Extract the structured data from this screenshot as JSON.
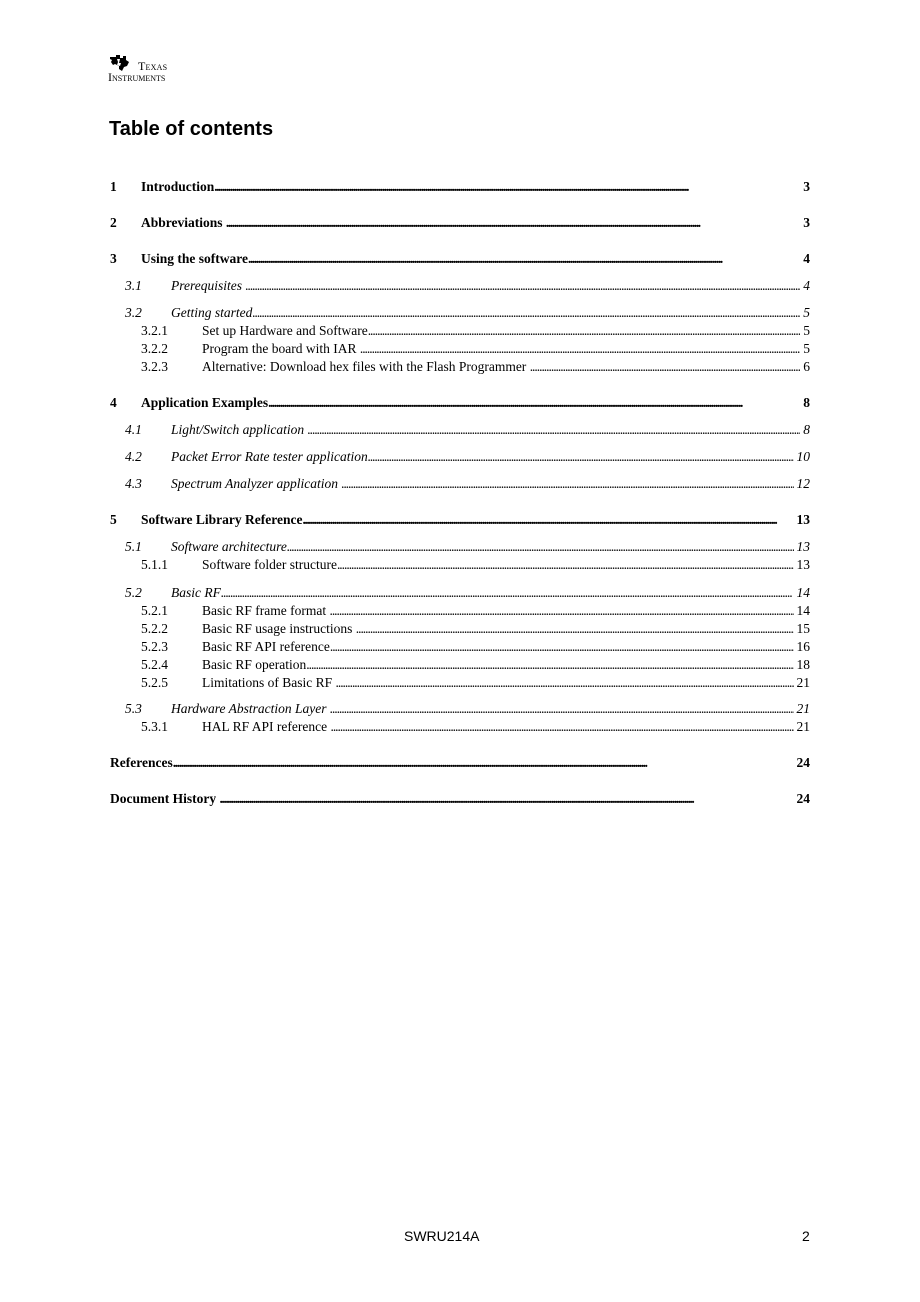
{
  "header": {
    "logo_line1": "Texas",
    "logo_line2": "Instruments"
  },
  "title": "Table of contents",
  "toc": [
    {
      "level": 1,
      "num": "1",
      "label": "Introduction",
      "page": "3"
    },
    {
      "level": 1,
      "num": "2",
      "label": "Abbreviations ",
      "page": "3"
    },
    {
      "level": 1,
      "num": "3",
      "label": "Using the software",
      "page": "4"
    },
    {
      "level": 2,
      "num": "3.1",
      "label": "Prerequisites ",
      "page": "4"
    },
    {
      "level": 2,
      "num": "3.2",
      "label": "Getting started",
      "page": "5"
    },
    {
      "level": 3,
      "num": "3.2.1",
      "label": "Set up Hardware and Software",
      "page": "5"
    },
    {
      "level": 3,
      "num": "3.2.2",
      "label": "Program the board with IAR ",
      "page": "5"
    },
    {
      "level": 3,
      "num": "3.2.3",
      "label": "Alternative: Download hex files with the Flash Programmer ",
      "page": "6"
    },
    {
      "level": 1,
      "num": "4",
      "label": "Application Examples",
      "page": "8"
    },
    {
      "level": 2,
      "num": "4.1",
      "label": "Light/Switch application ",
      "page": "8"
    },
    {
      "level": 2,
      "num": "4.2",
      "label": "Packet Error Rate tester application",
      "page": "10"
    },
    {
      "level": 2,
      "num": "4.3",
      "label": "Spectrum Analyzer application ",
      "page": "12"
    },
    {
      "level": 1,
      "num": "5",
      "label": "Software Library Reference",
      "page": "13"
    },
    {
      "level": 2,
      "num": "5.1",
      "label": "Software architecture",
      "page": "13"
    },
    {
      "level": 3,
      "num": "5.1.1",
      "label": "Software folder structure",
      "page": "13"
    },
    {
      "level": 2,
      "num": "5.2",
      "label": "Basic RF",
      "page": "14"
    },
    {
      "level": 3,
      "num": "5.2.1",
      "label": "Basic RF frame format ",
      "page": "14"
    },
    {
      "level": 3,
      "num": "5.2.2",
      "label": "Basic RF usage instructions ",
      "page": "15"
    },
    {
      "level": 3,
      "num": "5.2.3",
      "label": "Basic RF API reference",
      "page": "16"
    },
    {
      "level": 3,
      "num": "5.2.4",
      "label": "Basic RF operation",
      "page": "18"
    },
    {
      "level": 3,
      "num": "5.2.5",
      "label": "Limitations of Basic RF ",
      "page": "21"
    },
    {
      "level": 2,
      "num": "5.3",
      "label": "Hardware Abstraction Layer ",
      "page": "21"
    },
    {
      "level": 3,
      "num": "5.3.1",
      "label": "HAL RF API reference ",
      "page": "21"
    },
    {
      "level": 0,
      "num": "",
      "label": "References",
      "page": "24"
    },
    {
      "level": 0,
      "num": "",
      "label": "Document History ",
      "page": "24"
    }
  ],
  "footer": {
    "doc_id": "SWRU214A",
    "page_number": "2"
  }
}
